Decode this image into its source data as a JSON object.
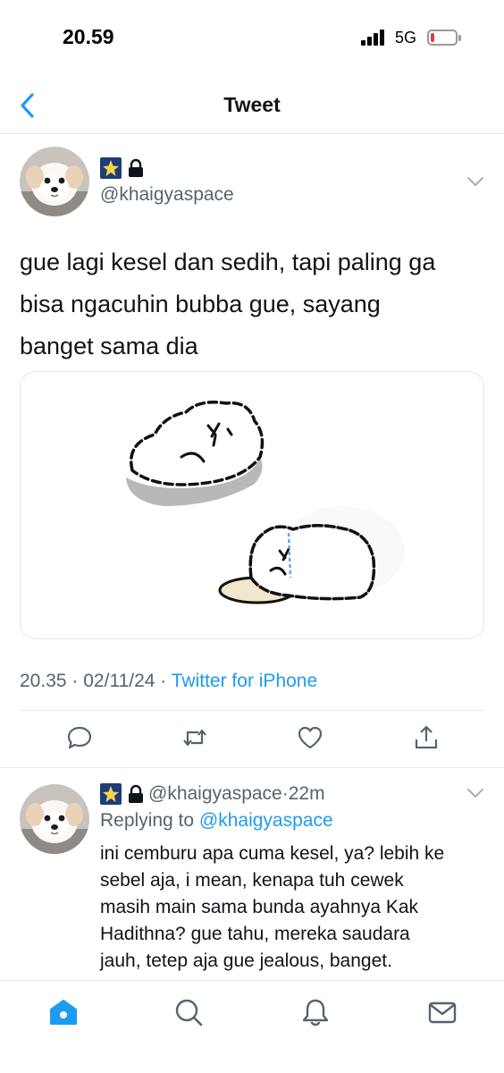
{
  "status_bar": {
    "time": "20.59",
    "network": "5G",
    "battery_level": 0.15,
    "battery_color": "#e63b3b"
  },
  "nav": {
    "back_icon": "chevron-left-icon",
    "title": "Tweet"
  },
  "tweet": {
    "display_name_icons": [
      "sparkle-star-emoji",
      "lock-icon"
    ],
    "handle": "@khaigyaspace",
    "text_lines": [
      "gue lagi kesel dan sedih, tapi paling ga",
      "bisa ngacuhin bubba gue, sayang",
      "banget sama dia"
    ],
    "media": "illustration of two fluffy white dogs lying down, one crying",
    "time": "20.35",
    "date": "02/11/24",
    "separator": "·",
    "source": "Twitter for iPhone",
    "actions": [
      "reply-icon",
      "retweet-icon",
      "like-icon",
      "share-icon"
    ]
  },
  "reply": {
    "display_name_icons": [
      "sparkle-star-emoji",
      "lock-icon"
    ],
    "handle": "@khaigyaspace",
    "age": "22m",
    "separator": "·",
    "replying_prefix": "Replying to",
    "replying_to": "@khaigyaspace",
    "text_lines": [
      "ini cemburu apa cuma kesel, ya? lebih ke",
      "sebel aja, i mean, kenapa tuh cewek",
      "masih main sama bunda ayahnya Kak",
      "Hadithna? gue tahu, mereka saudara",
      "jauh, tetep aja gue jealous, banget."
    ]
  },
  "tab_bar": {
    "items": [
      "home-icon",
      "search-icon",
      "notifications-icon",
      "messages-icon"
    ],
    "active": "home-icon",
    "accent_color": "#1d9bf0"
  }
}
